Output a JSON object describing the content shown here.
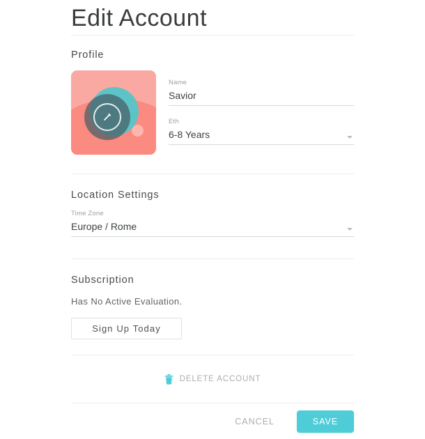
{
  "page": {
    "title": "Edit Account"
  },
  "profile": {
    "heading": "Profile",
    "avatar": {
      "icon": "edit-pencil-icon",
      "background_color": "#fb8b80",
      "accent_color": "#5ec3c6"
    },
    "name_field": {
      "label": "Name",
      "value": "Savior"
    },
    "eth_field": {
      "label": "Eth",
      "value": "6-8 Years"
    }
  },
  "location": {
    "heading": "Location Settings",
    "timezone_field": {
      "label": "Time Zone",
      "value": "Europe / Rome"
    }
  },
  "subscription": {
    "heading": "Subscription",
    "status_text": "Has No Active Evaluation.",
    "signup_label": "Sign Up Today"
  },
  "danger_zone": {
    "delete_label": "DELETE ACCOUNT",
    "delete_icon": "trash-icon",
    "delete_icon_color": "#4ecdd8"
  },
  "footer": {
    "cancel_label": "CANCEL",
    "save_label": "SAVE",
    "save_color": "#4ecdd8"
  }
}
